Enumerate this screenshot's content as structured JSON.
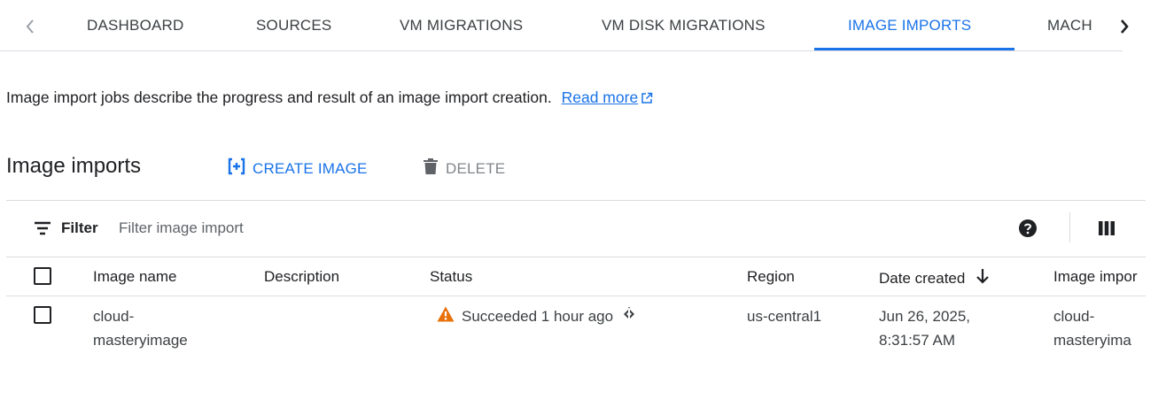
{
  "tabs": {
    "items": [
      {
        "label": "DASHBOARD"
      },
      {
        "label": "SOURCES"
      },
      {
        "label": "VM MIGRATIONS"
      },
      {
        "label": "VM DISK MIGRATIONS"
      },
      {
        "label": "IMAGE IMPORTS"
      },
      {
        "label": "MACH"
      }
    ],
    "active": "IMAGE IMPORTS"
  },
  "description": {
    "text": "Image import jobs describe the progress and result of an image import creation.",
    "link_label": "Read more"
  },
  "section": {
    "title": "Image imports",
    "create_label": "CREATE IMAGE",
    "delete_label": "DELETE"
  },
  "filter": {
    "label": "Filter",
    "placeholder": "Filter image import"
  },
  "table": {
    "columns": [
      "Image name",
      "Description",
      "Status",
      "Region",
      "Date created",
      "Image impor"
    ],
    "sort": {
      "column": "Date created",
      "direction": "descending"
    },
    "rows": [
      {
        "image_name_line1": "cloud-",
        "image_name_line2": "masteryimage",
        "description": "",
        "status": "Succeeded 1 hour ago",
        "region": "us-central1",
        "date_line1": "Jun 26, 2025,",
        "date_line2": "8:31:57 AM",
        "image_import_line1": "cloud-",
        "image_import_line2": "masteryima"
      }
    ]
  },
  "colors": {
    "accent": "#1a73e8",
    "warning": "#e8710a",
    "text": "#202124",
    "muted": "#80868b",
    "divider": "#dadce0"
  },
  "icons": [
    "chevron-left-icon",
    "chevron-right-icon",
    "external-link-icon",
    "add-box-icon",
    "trash-icon",
    "filter-icon",
    "help-icon",
    "columns-icon",
    "sort-arrow-down-icon",
    "warning-icon",
    "api-diamond-icon"
  ]
}
